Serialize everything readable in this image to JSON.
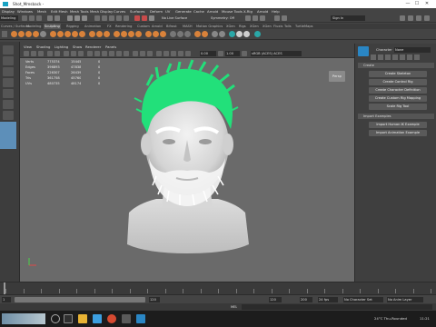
{
  "window": {
    "title": "Shot_Mmsback -",
    "close_glyph": "✕",
    "min_glyph": "—",
    "max_glyph": "☐"
  },
  "menubar": [
    "Display",
    "Windows",
    "Mesh",
    "Edit Mesh",
    "Mesh Tools",
    "Mesh Display",
    "Curves",
    "Surfaces",
    "Deform",
    "UV",
    "Generate",
    "Cache",
    "Arnold",
    "Mouse Tools",
    "X-Rig",
    "Arnold",
    "Help"
  ],
  "statusline": {
    "mode": "Modeling",
    "surface": "No Live Surface",
    "symmetry": "Symmetry: Off",
    "signin": "Sign In"
  },
  "shelf_tabs": [
    "Curves / Surfaces",
    "Modeling",
    "Sculpting",
    "Rigging",
    "Animation",
    "FX",
    "Rendering",
    "Custom",
    "Arnold",
    "Bifrost",
    "MASH",
    "Motion Graphics",
    "XGen",
    "Rigs",
    "XGen",
    "XGen",
    "Fluxis",
    "Tolls",
    "TurtleMaps"
  ],
  "viewport_menu": [
    "View",
    "Shading",
    "Lighting",
    "Show",
    "Renderer",
    "Panels"
  ],
  "viewport_toolbar": {
    "value1": "0.00",
    "value2": "1.00",
    "colorspace": "sRGB (ACES) ACES"
  },
  "stats": {
    "rows": [
      {
        "label": "Verts",
        "a": "775374",
        "b": "15445",
        "c": "0"
      },
      {
        "label": "Edges",
        "a": "396893",
        "b": "47838",
        "c": "0"
      },
      {
        "label": "Faces",
        "a": "226307",
        "b": "26439",
        "c": "0"
      },
      {
        "label": "Tris",
        "a": "361758",
        "b": "45760",
        "c": "0"
      },
      {
        "label": "UVs",
        "a": "480735",
        "b": "48174",
        "c": "0"
      }
    ]
  },
  "persp_label": "Persp",
  "right_panel": {
    "character_label": "Character",
    "character_value": "None",
    "create_section": "Create",
    "create_buttons": [
      "Create Skeleton",
      "Create Control Rig",
      "Create Character Definition",
      "Create Custom Rig Mapping",
      "Scale Rig Tool"
    ],
    "import_section": "Import Examples",
    "import_buttons": [
      "Import Human IK Example",
      "Import Animation Example"
    ]
  },
  "timeslider": {
    "ticks": [
      "1",
      "5",
      "10",
      "15",
      "20",
      "25",
      "30",
      "35",
      "40",
      "45",
      "50",
      "55",
      "60",
      "65",
      "70",
      "75",
      "80",
      "85",
      "90",
      "95",
      "100",
      "105",
      "110",
      "115",
      "120"
    ]
  },
  "rangebar": {
    "start": "1",
    "end_a": "120",
    "end_b": "200",
    "fps": "24 fps",
    "no_char": "No Character Set",
    "no_anim": "No Anim Layer"
  },
  "melbar": {
    "label": "MEL"
  },
  "taskbar": {
    "weather": "24°C  Thu-Rounded",
    "time": "11:21"
  },
  "colors": {
    "hair": "#22e07a",
    "accent": "#5d8fb9"
  }
}
